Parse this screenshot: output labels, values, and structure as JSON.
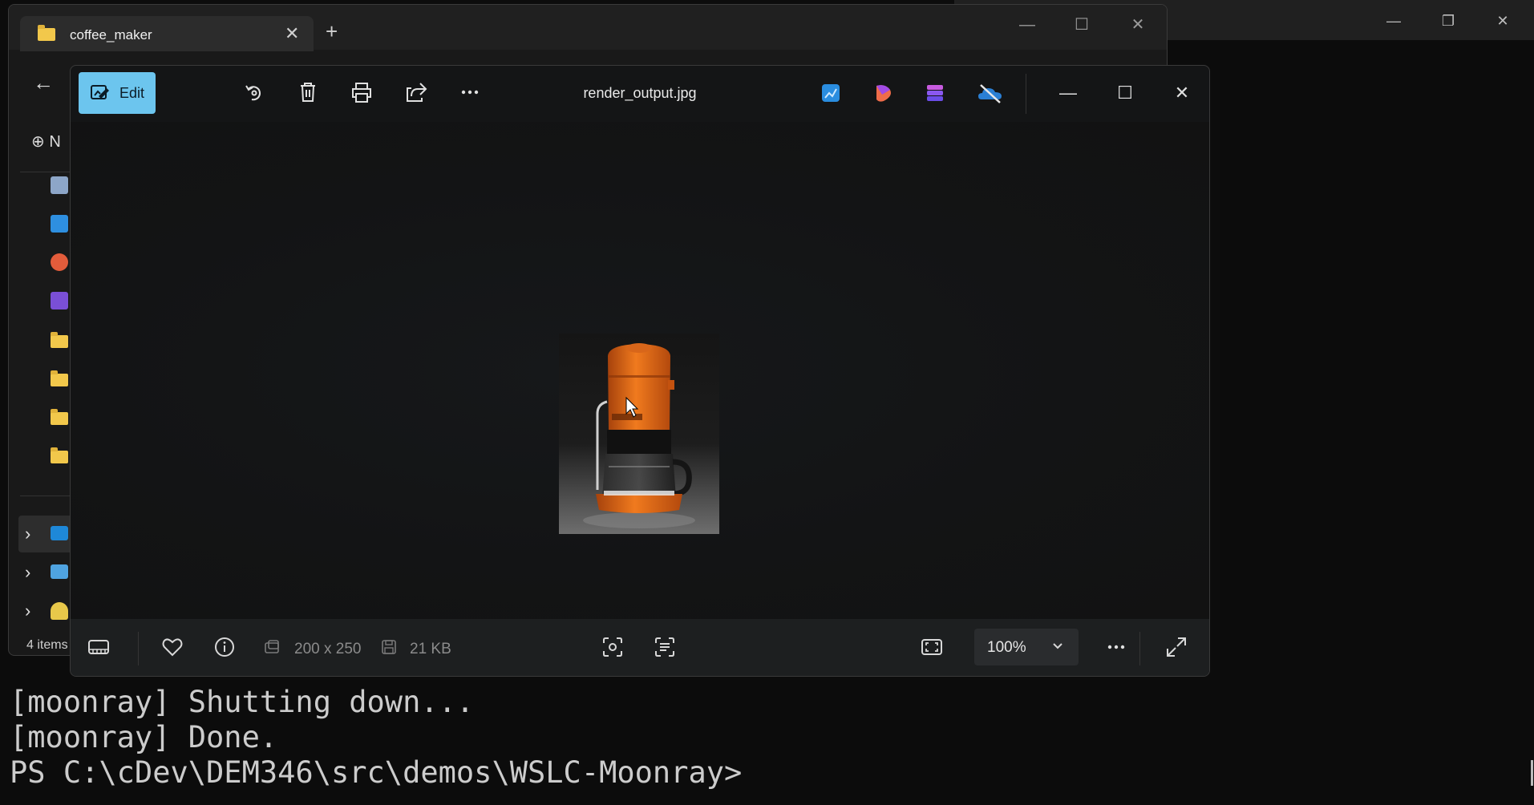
{
  "terminal": {
    "lines": [
      "[moonray] Shutting down...",
      "[moonray] Done.",
      "PS C:\\cDev\\DEM346\\src\\demos\\WSLC-Moonray>"
    ],
    "controls": {
      "minimize": "—",
      "restore": "❐",
      "close": "✕"
    },
    "background_color": "#0c0c0c"
  },
  "explorer": {
    "tab_title": "coffee_maker",
    "tab_close": "✕",
    "new_tab": "+",
    "back_icon": "←",
    "new_button_fragment": "⊕ N",
    "status_text": "4 items",
    "controls": {
      "minimize": "—",
      "maximize": "☐",
      "close": "✕"
    },
    "sidebar_icons": [
      "document-icon",
      "pictures-icon",
      "music-icon",
      "videos-icon",
      "folder-icon",
      "folder-icon",
      "folder-icon",
      "folder-icon"
    ],
    "tree_items": [
      "this-pc-icon",
      "network-icon",
      "linux-icon"
    ]
  },
  "photos": {
    "edit_label": "Edit",
    "file_name": "render_output.jpg",
    "dimensions": "200 x 250",
    "file_size": "21 KB",
    "zoom": "100%",
    "controls": {
      "minimize": "—",
      "maximize": "☐",
      "close": "✕"
    },
    "accent_color": "#6cc5ee",
    "toolbar_icons": [
      "rotate-icon",
      "delete-icon",
      "print-icon",
      "share-icon",
      "more-icon"
    ],
    "app_icons": [
      "photos-editor-icon",
      "clipchamp-icon",
      "designer-icon",
      "onedrive-icon"
    ],
    "bottom_icons": [
      "filmstrip-icon",
      "favorite-icon",
      "info-icon",
      "visual-search-icon",
      "text-scan-icon",
      "fit-window-icon",
      "more-icon",
      "fullscreen-icon"
    ]
  }
}
